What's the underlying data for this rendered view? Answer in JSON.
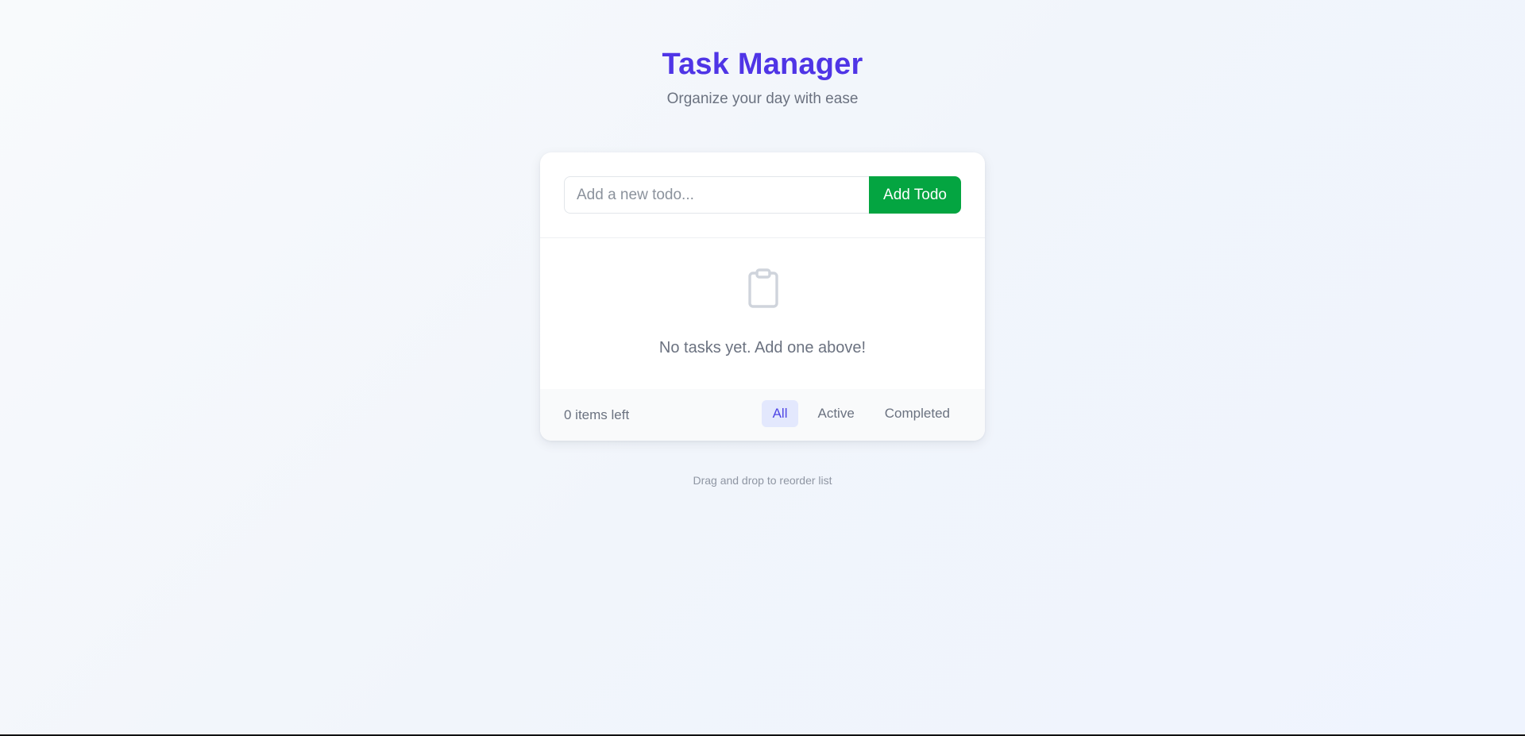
{
  "header": {
    "title": "Task Manager",
    "subtitle": "Organize your day with ease"
  },
  "input": {
    "placeholder": "Add a new todo...",
    "value": ""
  },
  "add_button": {
    "label": "Add Todo"
  },
  "empty_state": {
    "icon": "clipboard-icon",
    "message": "No tasks yet. Add one above!"
  },
  "footer": {
    "items_left": "0 items left",
    "filters": [
      {
        "label": "All",
        "active": true
      },
      {
        "label": "Active",
        "active": false
      },
      {
        "label": "Completed",
        "active": false
      }
    ]
  },
  "hint": "Drag and drop to reorder list",
  "colors": {
    "brand": "#4f35e6",
    "add_button": "#04a541",
    "active_filter_bg": "#e3e8fd",
    "active_filter_text": "#4f46e5"
  }
}
